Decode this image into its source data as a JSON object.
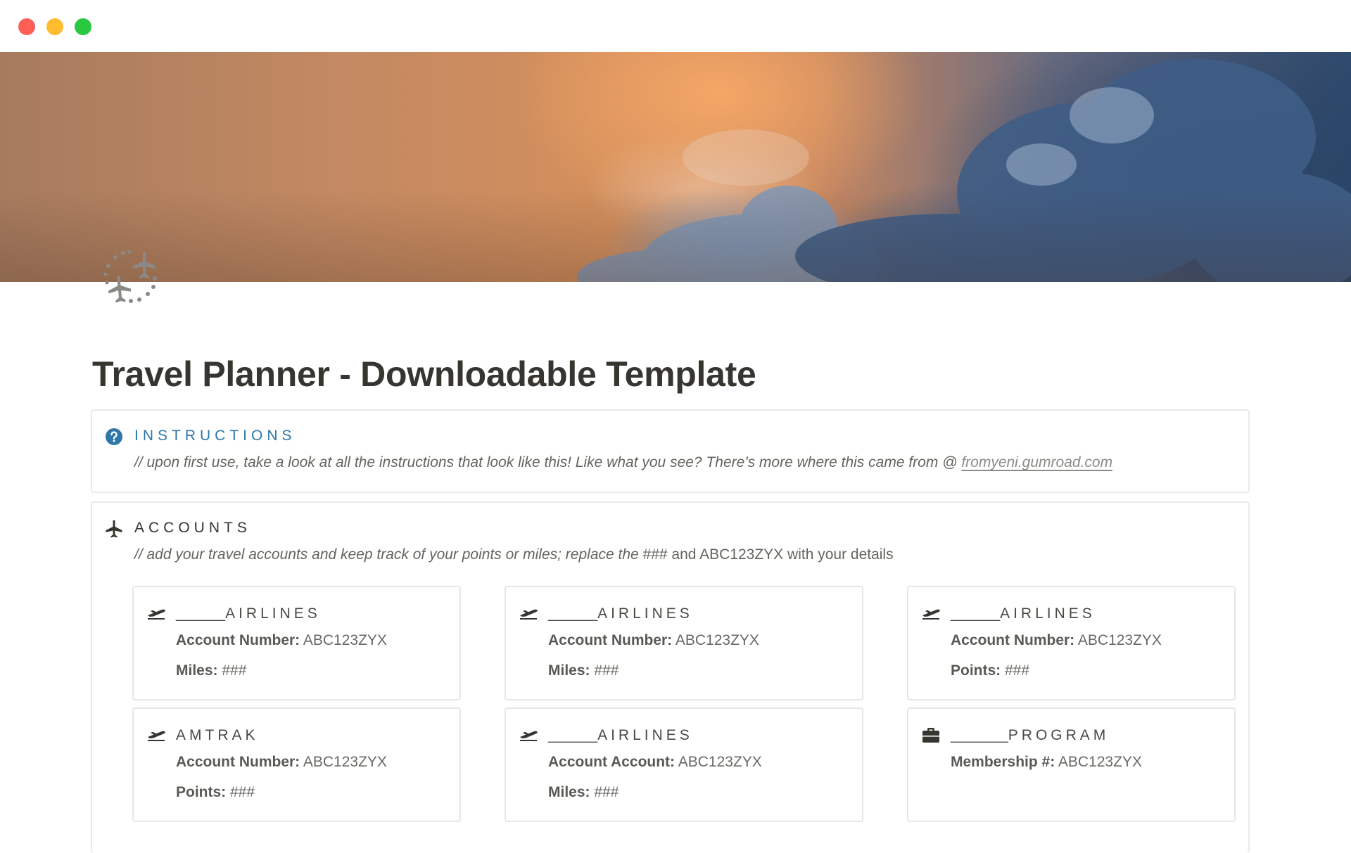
{
  "window": {
    "controls": [
      "close",
      "minimize",
      "zoom"
    ]
  },
  "page": {
    "icon": "airplanes-icon",
    "title": "Travel Planner - Downloadable Template"
  },
  "instructions": {
    "icon": "question-circle-icon",
    "heading": "INSTRUCTIONS",
    "text": "// upon first use, take a look at all the instructions that look like this! Like what you see? There’s more where this came from @ ",
    "link": "fromyeni.gumroad.com",
    "accent_color": "#2e77a8"
  },
  "accounts": {
    "icon": "airplane-icon",
    "heading": "ACCOUNTS",
    "text_italic": "// add your travel accounts and keep track of your points or miles; replace the ",
    "text_plain": "### and ABC123ZYX with your details",
    "cards": [
      {
        "icon": "departure-icon",
        "blank": "______",
        "name": "AIRLINES",
        "line1_label": "Account Number:",
        "line1_value": " ABC123ZYX",
        "line2_label": "Miles:",
        "line2_value": " ###"
      },
      {
        "icon": "departure-icon",
        "blank": "______",
        "name": "AIRLINES",
        "line1_label": "Account Number:",
        "line1_value": " ABC123ZYX",
        "line2_label": "Miles:",
        "line2_value": " ###"
      },
      {
        "icon": "departure-icon",
        "blank": "______",
        "name": "AIRLINES",
        "line1_label": "Account Number:",
        "line1_value": " ABC123ZYX",
        "line2_label": "Points:",
        "line2_value": " ###"
      },
      {
        "icon": "departure-icon",
        "blank": "",
        "name": "AMTRAK",
        "line1_label": "Account Number:",
        "line1_value": " ABC123ZYX",
        "line2_label": "Points:",
        "line2_value": " ###"
      },
      {
        "icon": "departure-icon",
        "blank": "______",
        "name": "AIRLINES",
        "line1_label": "Account Account:",
        "line1_value": " ABC123ZYX",
        "line2_label": "Miles:",
        "line2_value": " ###"
      },
      {
        "icon": "briefcase-icon",
        "blank": "_______",
        "name": "PROGRAM",
        "line1_label": "Membership #:",
        "line1_value": " ABC123ZYX",
        "line2_label": "",
        "line2_value": ""
      }
    ]
  }
}
